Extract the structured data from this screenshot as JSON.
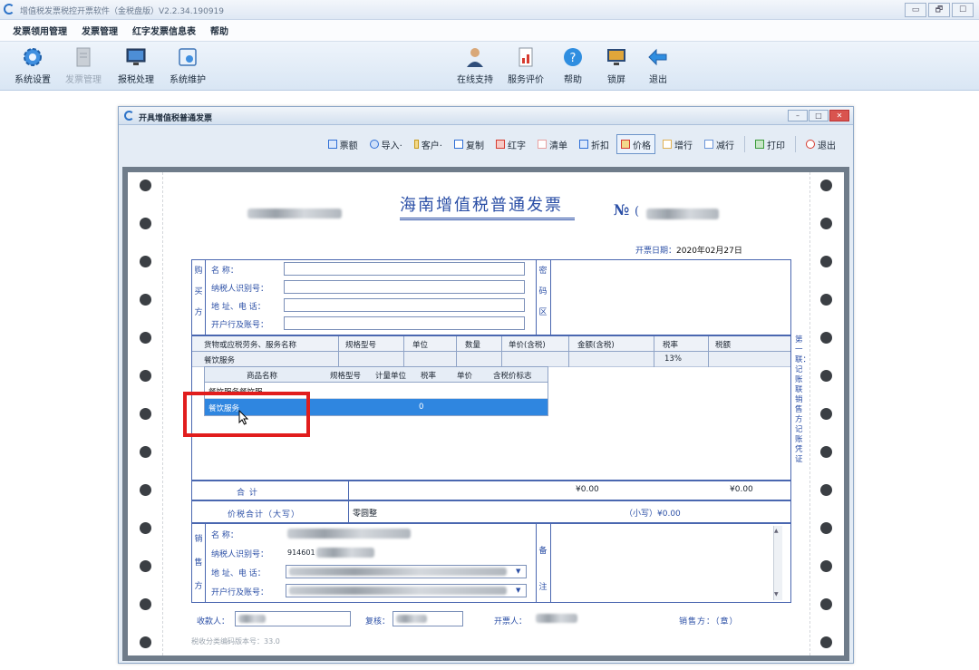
{
  "app": {
    "title": "增值税发票税控开票软件（金税盘版）V2.2.34.190919",
    "window_controls": [
      "▭",
      "🗗",
      "☐"
    ]
  },
  "menu": [
    "发票领用管理",
    "发票管理",
    "红字发票信息表",
    "帮助"
  ],
  "toolbar": {
    "left": [
      {
        "label": "系统设置",
        "icon": "gear-icon",
        "enabled": true
      },
      {
        "label": "发票管理",
        "icon": "invoice-icon",
        "enabled": false
      },
      {
        "label": "报税处理",
        "icon": "monitor-icon",
        "enabled": true
      },
      {
        "label": "系统维护",
        "icon": "maintenance-icon",
        "enabled": true
      }
    ],
    "right": [
      {
        "label": "在线支持",
        "icon": "support-person-icon"
      },
      {
        "label": "服务评价",
        "icon": "rating-icon"
      },
      {
        "label": "帮助",
        "icon": "help-icon"
      },
      {
        "label": "锁屏",
        "icon": "lock-screen-icon"
      },
      {
        "label": "退出",
        "icon": "exit-arrow-icon"
      }
    ]
  },
  "child_window": {
    "title": "开具增值税普通发票",
    "controls": [
      "–",
      "□",
      "✕"
    ],
    "toolbar": [
      {
        "label": "票额",
        "color": "#2f6fd6"
      },
      {
        "label": "导入·",
        "color": "#2f6fd6"
      },
      {
        "label": "客户·",
        "color": "#c89a1a"
      },
      {
        "label": "复制",
        "color": "#2f6fd6"
      },
      {
        "label": "红字",
        "color": "#d63a2f"
      },
      {
        "label": "清单",
        "color": "#7a8fb8"
      },
      {
        "label": "折扣",
        "color": "#2f6fd6"
      },
      {
        "label": "价格",
        "color": "#d63a2f",
        "active": true
      },
      {
        "label": "增行",
        "color": "#c89a1a"
      },
      {
        "label": "减行",
        "color": "#2f6fd6"
      },
      {
        "label": "打印",
        "color": "#3a9a3a"
      },
      {
        "label": "退出",
        "color": "#d63a2f"
      }
    ]
  },
  "invoice": {
    "title": "海南增值税普通发票",
    "no_label": "№",
    "no_prefix": "(",
    "date_label": "开票日期：",
    "date_value": "2020年02月27日",
    "buyer_side": [
      "购",
      "买",
      "方"
    ],
    "buyer_fields": [
      "名        称：",
      "纳税人识别号：",
      "地 址、电 话：",
      "开户行及账号："
    ],
    "secret_side": [
      "密",
      "码",
      "区"
    ],
    "goods_headers": [
      "货物或应税劳务、服务名称",
      "规格型号",
      "单位",
      "数量",
      "单价(含税)",
      "金额(含税)",
      "税率",
      "税额"
    ],
    "goods_row": {
      "name": "餐饮服务",
      "tax_rate": "13%"
    },
    "sub_headers": [
      "商品名称",
      "规格型号",
      "计量单位",
      "税率",
      "单价",
      "含税价标志"
    ],
    "sub_rows": [
      {
        "name": "餐饮服务餐饮服",
        "tax_rate": ""
      },
      {
        "name": "餐饮服务",
        "tax_rate": "0"
      }
    ],
    "total_label": "合        计",
    "total_amount": "¥0.00",
    "total_tax": "¥0.00",
    "total_upper_label": "价税合计（大写）",
    "total_upper_value": "零圆整",
    "total_lower": "（小写）¥0.00",
    "seller_side": [
      "销",
      "售",
      "方"
    ],
    "seller_fields": [
      "名        称：",
      "纳税人识别号：",
      "地 址、电 话：",
      "开户行及账号："
    ],
    "seller_tax_prefix": "914601",
    "remark_side": [
      "备",
      "注"
    ],
    "right_vertical": "第一联：记账联  销售方记账凭证",
    "payee_label": "收款人：",
    "reviewer_label": "复核：",
    "drawer_label": "开票人：",
    "seal_label": "销售方：（章）",
    "footer_note": "税收分类编码版本号：33.0"
  }
}
